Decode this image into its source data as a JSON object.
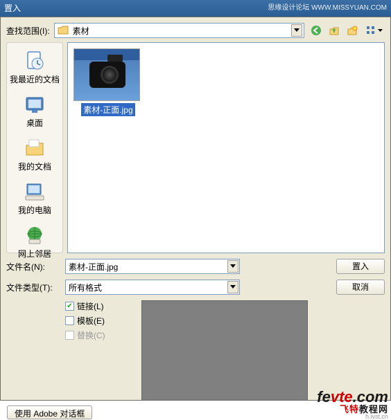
{
  "titlebar": {
    "title": "置入",
    "right": "思缘设计论坛  WWW.MISSYUAN.COM"
  },
  "lookin": {
    "label": "查找范围(I):",
    "value": "素材"
  },
  "sidebar": {
    "items": [
      {
        "label": "我最近的文档"
      },
      {
        "label": "桌面"
      },
      {
        "label": "我的文档"
      },
      {
        "label": "我的电脑"
      },
      {
        "label": "网上邻居"
      }
    ]
  },
  "file": {
    "thumb_label": "素材-正面.jpg"
  },
  "filename": {
    "label": "文件名(N):",
    "value": "素材-正面.jpg"
  },
  "filetype": {
    "label": "文件类型(T):",
    "value": "所有格式"
  },
  "buttons": {
    "place": "置入",
    "cancel": "取消"
  },
  "checks": {
    "link": "链接(L)",
    "template": "模板(E)",
    "replace": "替换(C)"
  },
  "bottom": {
    "adobe": "使用 Adobe 对话框"
  },
  "watermark": {
    "fe": "fe",
    "vte": "vte",
    "dotcom": ".com",
    "sub_pre": "飞特",
    "sub_post": "教程网",
    "url": "h.ivst.cn"
  }
}
